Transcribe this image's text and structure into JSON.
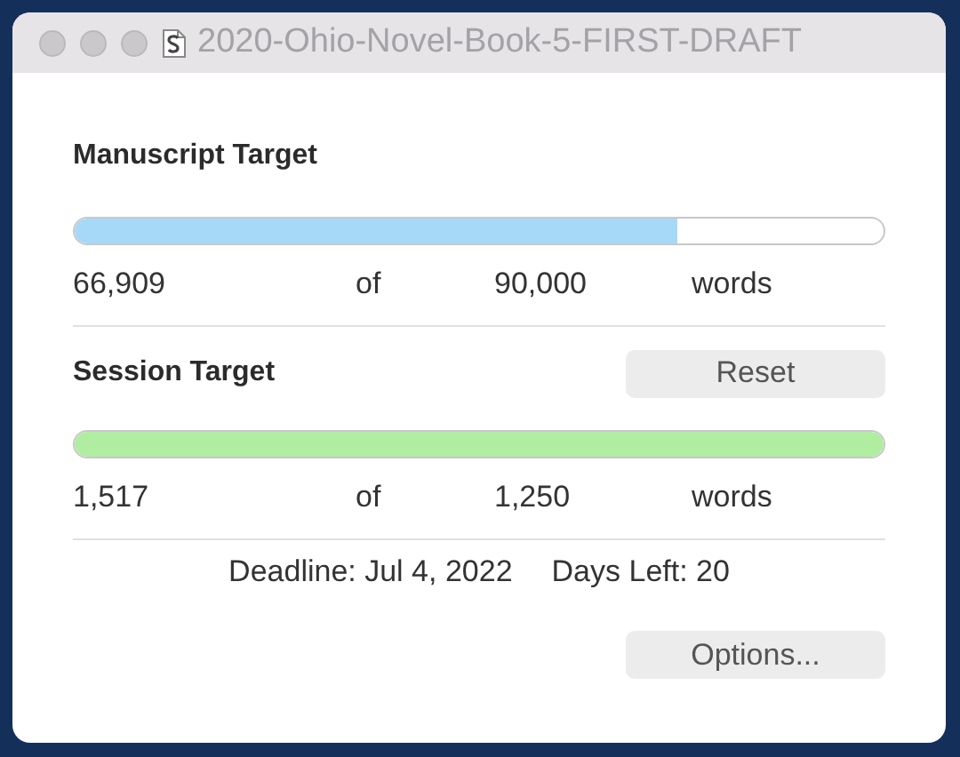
{
  "window": {
    "title": "2020-Ohio-Novel-Book-5-FIRST-DRAFT"
  },
  "targets": [
    {
      "title": "Manuscript Target",
      "level": 0.744,
      "color": "#a6d8f8",
      "count": "66,909",
      "of": "of",
      "goal": "90,000",
      "unit": "words"
    },
    {
      "title": "Session Target",
      "button": "Reset",
      "level": 1,
      "color": "#b1eda1",
      "count": "1,517",
      "of": "of",
      "goal": "1,250",
      "unit": "words"
    }
  ],
  "deadline": "Deadline: Jul 4, 2022",
  "days_left": "Days Left: 20",
  "buttons": [
    "Options..."
  ]
}
